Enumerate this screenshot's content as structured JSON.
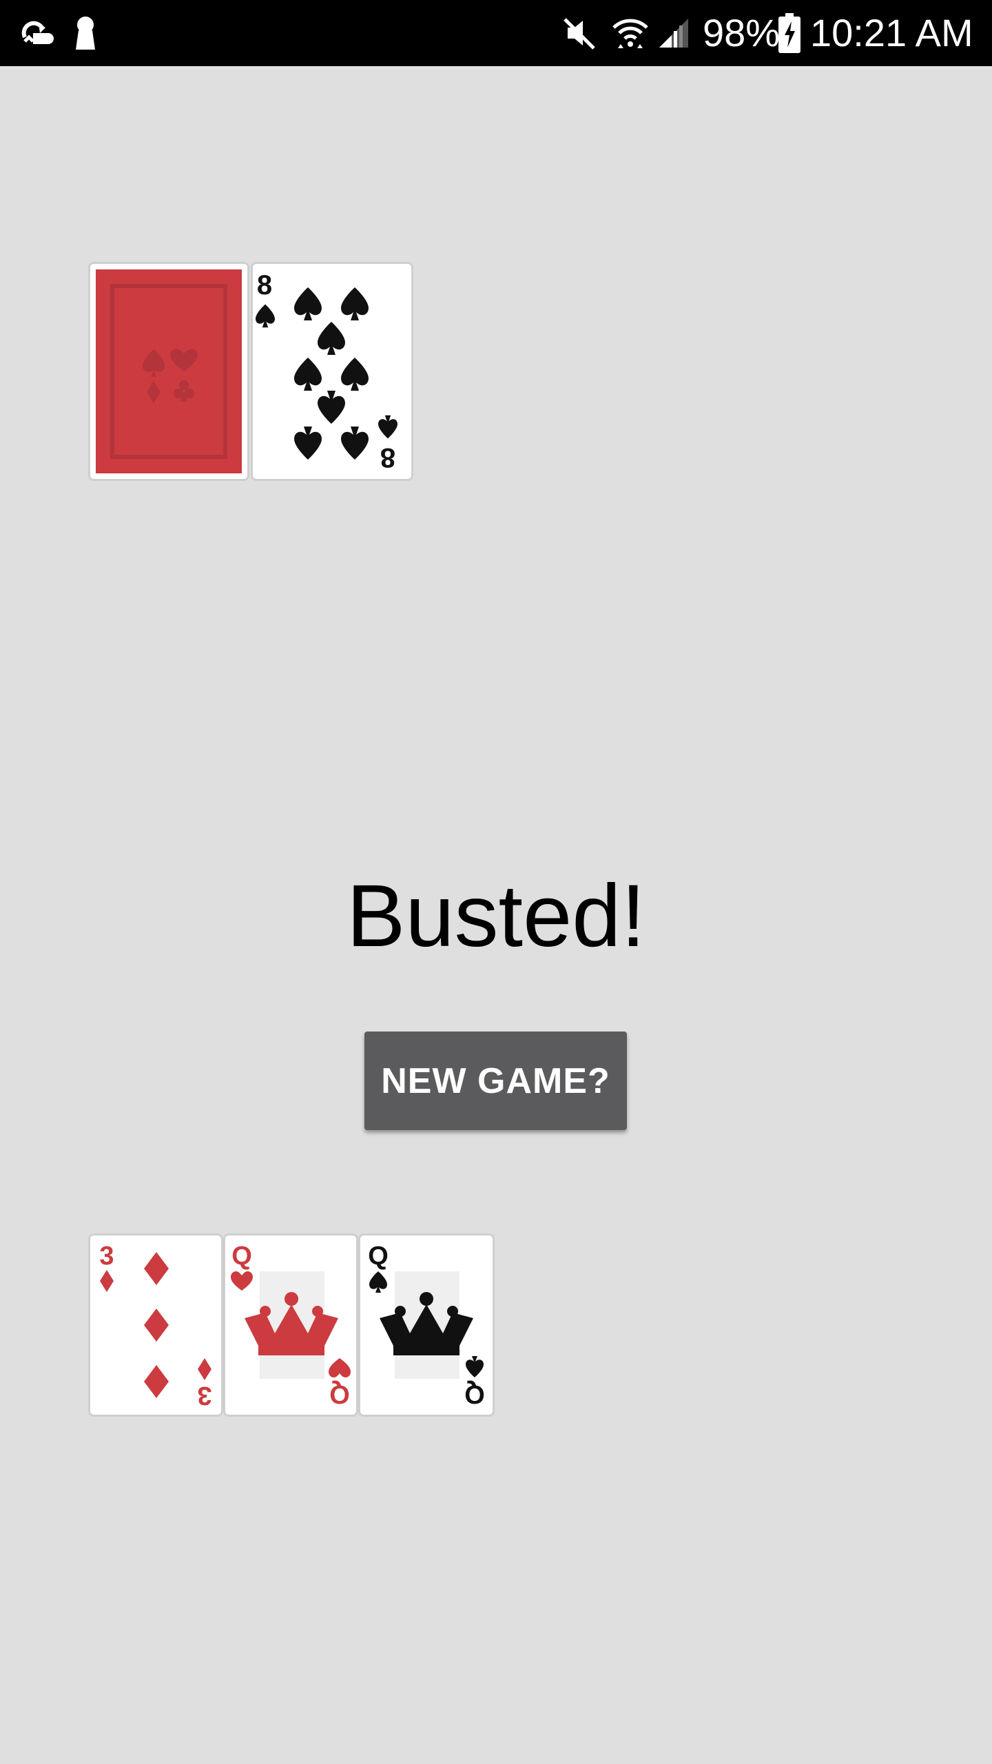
{
  "status_bar": {
    "battery": "98%",
    "time": "10:21 AM",
    "icons": [
      "sync-icon",
      "keyhole-icon",
      "mute-icon",
      "wifi-icon",
      "signal-icon",
      "battery-charging-icon"
    ]
  },
  "dealer_hand": {
    "cards": [
      {
        "face_down": true,
        "back_color": "#cc3b3f"
      },
      {
        "rank": "8",
        "suit": "spades",
        "color": "#111111"
      }
    ]
  },
  "player_hand": {
    "cards": [
      {
        "rank": "3",
        "suit": "diamonds",
        "color": "#cc3b3f"
      },
      {
        "rank": "Q",
        "suit": "hearts",
        "color": "#cc3b3f"
      },
      {
        "rank": "Q",
        "suit": "spades",
        "color": "#111111"
      }
    ]
  },
  "result": {
    "message": "Busted!"
  },
  "actions": {
    "new_game_label": "NEW GAME?"
  },
  "colors": {
    "background": "#dfdfdf",
    "button": "#5b5b5e",
    "red": "#cc3b3f",
    "black": "#111111"
  }
}
